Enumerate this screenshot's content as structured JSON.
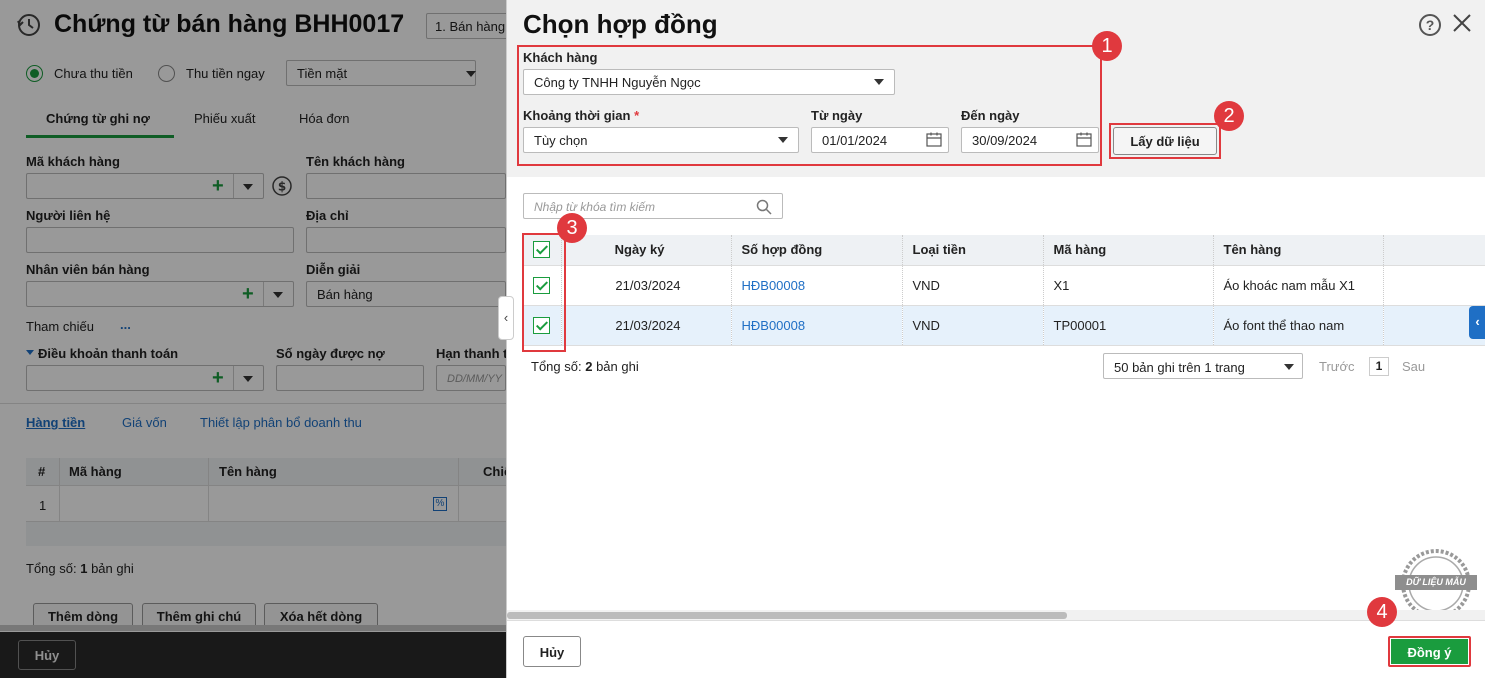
{
  "background": {
    "title": "Chứng từ bán hàng BHH0017",
    "type_select": "1. Bán hàng",
    "payment_radio": [
      {
        "label": "Chưa thu tiền",
        "checked": true
      },
      {
        "label": "Thu tiền ngay",
        "checked": false
      }
    ],
    "payment_method": "Tiền mặt",
    "tabs": [
      "Chứng từ ghi nợ",
      "Phiếu xuất",
      "Hóa đơn"
    ],
    "labels": {
      "customer_code": "Mã khách hàng",
      "customer_name": "Tên khách hàng",
      "contact": "Người liên hệ",
      "address": "Địa chỉ",
      "salesperson": "Nhân viên bán hàng",
      "description": "Diễn giải",
      "reference": "Tham chiếu",
      "reference_more": "...",
      "payment_terms": "Điều khoản thanh toán",
      "debt_days": "Số ngày được nợ",
      "due_date": "Hạn thanh t"
    },
    "description_value": "Bán hàng",
    "due_date_placeholder": "DD/MM/YY",
    "sub_tabs": [
      "Hàng tiền",
      "Giá vốn",
      "Thiết lập phân bổ doanh thu"
    ],
    "grid_headers": [
      "#",
      "Mã hàng",
      "Tên hàng",
      "Chiế"
    ],
    "grid_row_no": "1",
    "total_prefix": "Tổng số:",
    "total_count": "1",
    "total_suffix": "bản ghi",
    "buttons": [
      "Thêm dòng",
      "Thêm ghi chú",
      "Xóa hết dòng"
    ],
    "cancel_label": "Hủy"
  },
  "dialog": {
    "title": "Chọn hợp đồng",
    "customer_label": "Khách hàng",
    "customer_value": "Công ty TNHH Nguyễn Ngọc",
    "period_label": "Khoảng thời gian",
    "period_required": "*",
    "period_value": "Tùy chọn",
    "from_label": "Từ ngày",
    "from_value": "01/01/2024",
    "to_label": "Đến ngày",
    "to_value": "30/09/2024",
    "get_data_button": "Lấy dữ liệu",
    "search_placeholder": "Nhập từ khóa tìm kiếm",
    "columns": [
      "Ngày ký",
      "Số hợp đồng",
      "Loại tiền",
      "Mã hàng",
      "Tên hàng"
    ],
    "rows": [
      {
        "date": "21/03/2024",
        "contract": "HĐB00008",
        "currency": "VND",
        "item_code": "X1",
        "item_name": "Áo khoác nam mẫu X1",
        "checked": true
      },
      {
        "date": "21/03/2024",
        "contract": "HĐB00008",
        "currency": "VND",
        "item_code": "TP00001",
        "item_name": "Áo font thể thao nam",
        "checked": true
      }
    ],
    "total_prefix": "Tổng số:",
    "total_count": "2",
    "total_suffix": "bản ghi",
    "page_size": "50 bản ghi trên 1 trang",
    "prev": "Trước",
    "page": "1",
    "next": "Sau",
    "cancel_button": "Hủy",
    "ok_button": "Đồng ý",
    "stamp_text": "DỮ LIỆU MẪU",
    "callouts": [
      "1",
      "2",
      "3",
      "4"
    ]
  },
  "colors": {
    "accent_green": "#1a9c3e",
    "highlight_red": "#e0393e",
    "link_blue": "#1f6fc5"
  }
}
